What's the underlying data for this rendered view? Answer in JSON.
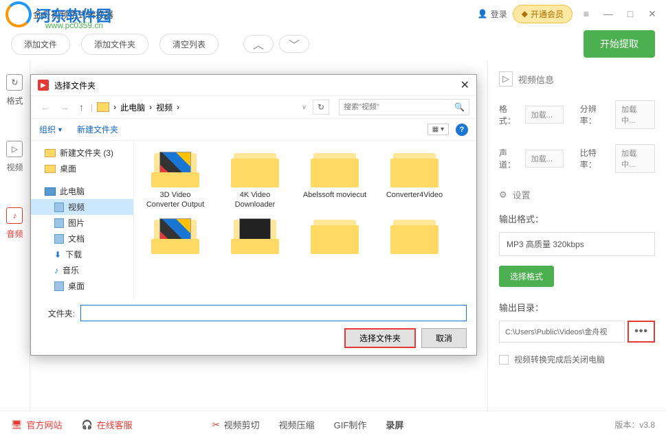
{
  "app": {
    "title": "金舟视频格式转换器"
  },
  "watermark": {
    "text": "河东软件园",
    "url": "www.pc0359.cn"
  },
  "top": {
    "login": "登录",
    "vip": "开通会员"
  },
  "toolbar": {
    "add_file": "添加文件",
    "add_folder": "添加文件夹",
    "clear": "清空列表",
    "start": "开始提取"
  },
  "left_tabs": {
    "format": "格式",
    "video": "视频",
    "audio": "音频"
  },
  "right": {
    "video_info": "视频信息",
    "format": "格式：",
    "resolution": "分辨率：",
    "channel": "声道：",
    "bitrate": "比特率：",
    "loading": "加载...",
    "loading2": "加载中...",
    "settings": "设置",
    "out_format": "输出格式：",
    "out_format_val": "MP3 高质量 320kbps",
    "select_format": "选择格式",
    "out_dir": "输出目录：",
    "out_dir_val": "C:\\Users\\Public\\Videos\\金舟视",
    "shutdown": "视频转换完成后关闭电脑"
  },
  "bottom": {
    "website": "官方网站",
    "support": "在线客服",
    "cut": "视频剪切",
    "compress": "视频压缩",
    "gif": "GIF制作",
    "record": "录屏",
    "version": "版本：v3.8"
  },
  "dialog": {
    "title": "选择文件夹",
    "crumb1": "此电脑",
    "crumb2": "视频",
    "search_ph": "搜索\"视频\"",
    "organize": "组织",
    "new_folder": "新建文件夹",
    "tree": {
      "new_folder": "新建文件夹 (3)",
      "desktop": "桌面",
      "pc": "此电脑",
      "video": "视频",
      "pictures": "图片",
      "docs": "文档",
      "downloads": "下载",
      "music": "音乐",
      "desktop2": "桌面"
    },
    "folders": [
      "3D Video Converter Output",
      "4K Video Downloader",
      "Abelssoft moviecut",
      "Converter4Video"
    ],
    "fname": "文件夹:",
    "select": "选择文件夹",
    "cancel": "取消"
  }
}
